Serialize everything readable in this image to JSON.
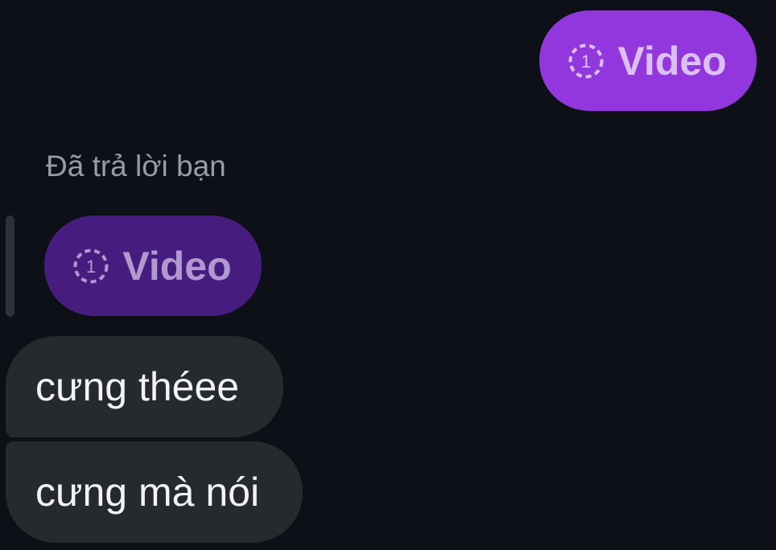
{
  "sent_message": {
    "type_label": "Video",
    "icon": "dashed-circle-one-icon",
    "icon_text": "1",
    "bubble_color": "#9237dd"
  },
  "reply": {
    "caption": "Đã trả lời bạn",
    "quoted": {
      "type_label": "Video",
      "icon": "dashed-circle-one-icon",
      "icon_text": "1",
      "bubble_color": "#471c7f"
    }
  },
  "received_messages": [
    {
      "text": "cưng théee"
    },
    {
      "text": "cưng mà nói"
    }
  ]
}
